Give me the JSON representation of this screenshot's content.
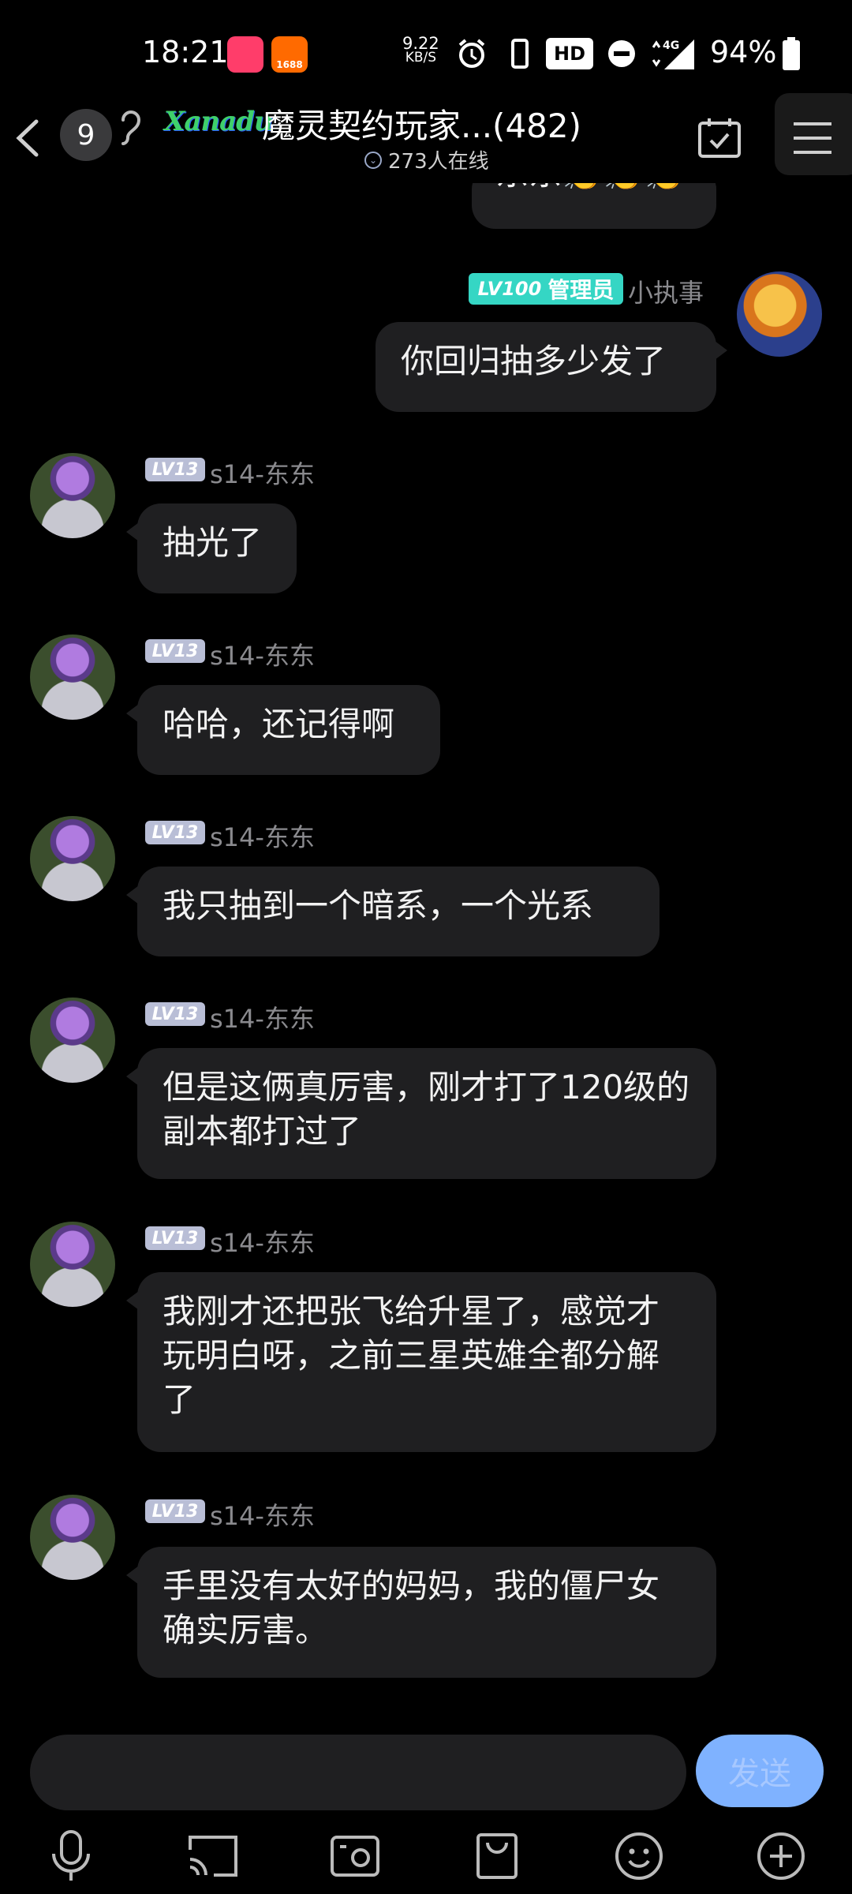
{
  "status_bar": {
    "time": "18:21",
    "app1": "",
    "app2": "1688",
    "speed_value": "9.22",
    "speed_unit": "KB/S",
    "hd": "HD",
    "network": "4G",
    "battery": "94%"
  },
  "header": {
    "unread_count": "9",
    "group_logo_text": "Xanadu",
    "group_title": "魔灵契约玩家...(482)",
    "online": "273人在线"
  },
  "messages": [
    {
      "side": "right",
      "text": "东东👏👏👏",
      "partial": true
    },
    {
      "side": "right",
      "level": "LV100",
      "role": "管理员",
      "nick": "小执事",
      "text": "你回归抽多少发了"
    },
    {
      "side": "left",
      "level": "LV13",
      "nick": "s14-东东",
      "text": "抽光了"
    },
    {
      "side": "left",
      "level": "LV13",
      "nick": "s14-东东",
      "text": "哈哈，还记得啊"
    },
    {
      "side": "left",
      "level": "LV13",
      "nick": "s14-东东",
      "text": "我只抽到一个暗系，一个光系"
    },
    {
      "side": "left",
      "level": "LV13",
      "nick": "s14-东东",
      "text": "但是这俩真厉害，刚才打了120级的副本都打过了"
    },
    {
      "side": "left",
      "level": "LV13",
      "nick": "s14-东东",
      "text": "我刚才还把张飞给升星了，感觉才玩明白呀，之前三星英雄全都分解了"
    },
    {
      "side": "left",
      "level": "LV13",
      "nick": "s14-东东",
      "text": "手里没有太好的妈妈，我的僵尸女确实厉害。"
    }
  ],
  "input": {
    "placeholder": "",
    "send_label": "发送"
  },
  "toolbar": [
    "mic-icon",
    "cast-icon",
    "photo-icon",
    "shopping-bag-icon",
    "emoji-icon",
    "plus-icon"
  ],
  "colors": {
    "background": "#000000",
    "bubble": "#1f1f21",
    "admin_badge": "#35d6c4",
    "level_badge": "#b9bed6",
    "send_button": "#7fb2ff"
  }
}
